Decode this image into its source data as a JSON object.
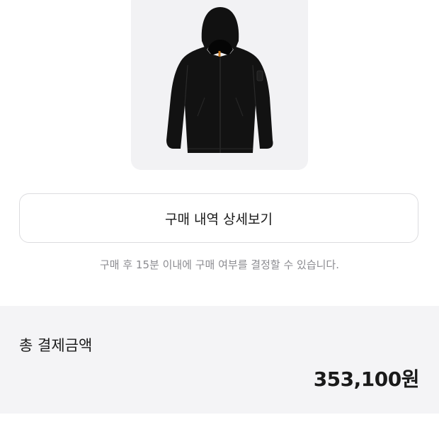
{
  "product": {
    "image_icon": "black-hooded-jacket"
  },
  "actions": {
    "detail_label": "구매 내역 상세보기"
  },
  "notice": {
    "text": "구매 후 15분 이내에 구매 여부를 결정할 수 있습니다."
  },
  "summary": {
    "label": "총 결제금액",
    "amount": "353,100원"
  },
  "colors": {
    "summary_background": "#f4f4f6",
    "card_background": "#f2f2f4",
    "notice_text": "#8b8b90"
  }
}
